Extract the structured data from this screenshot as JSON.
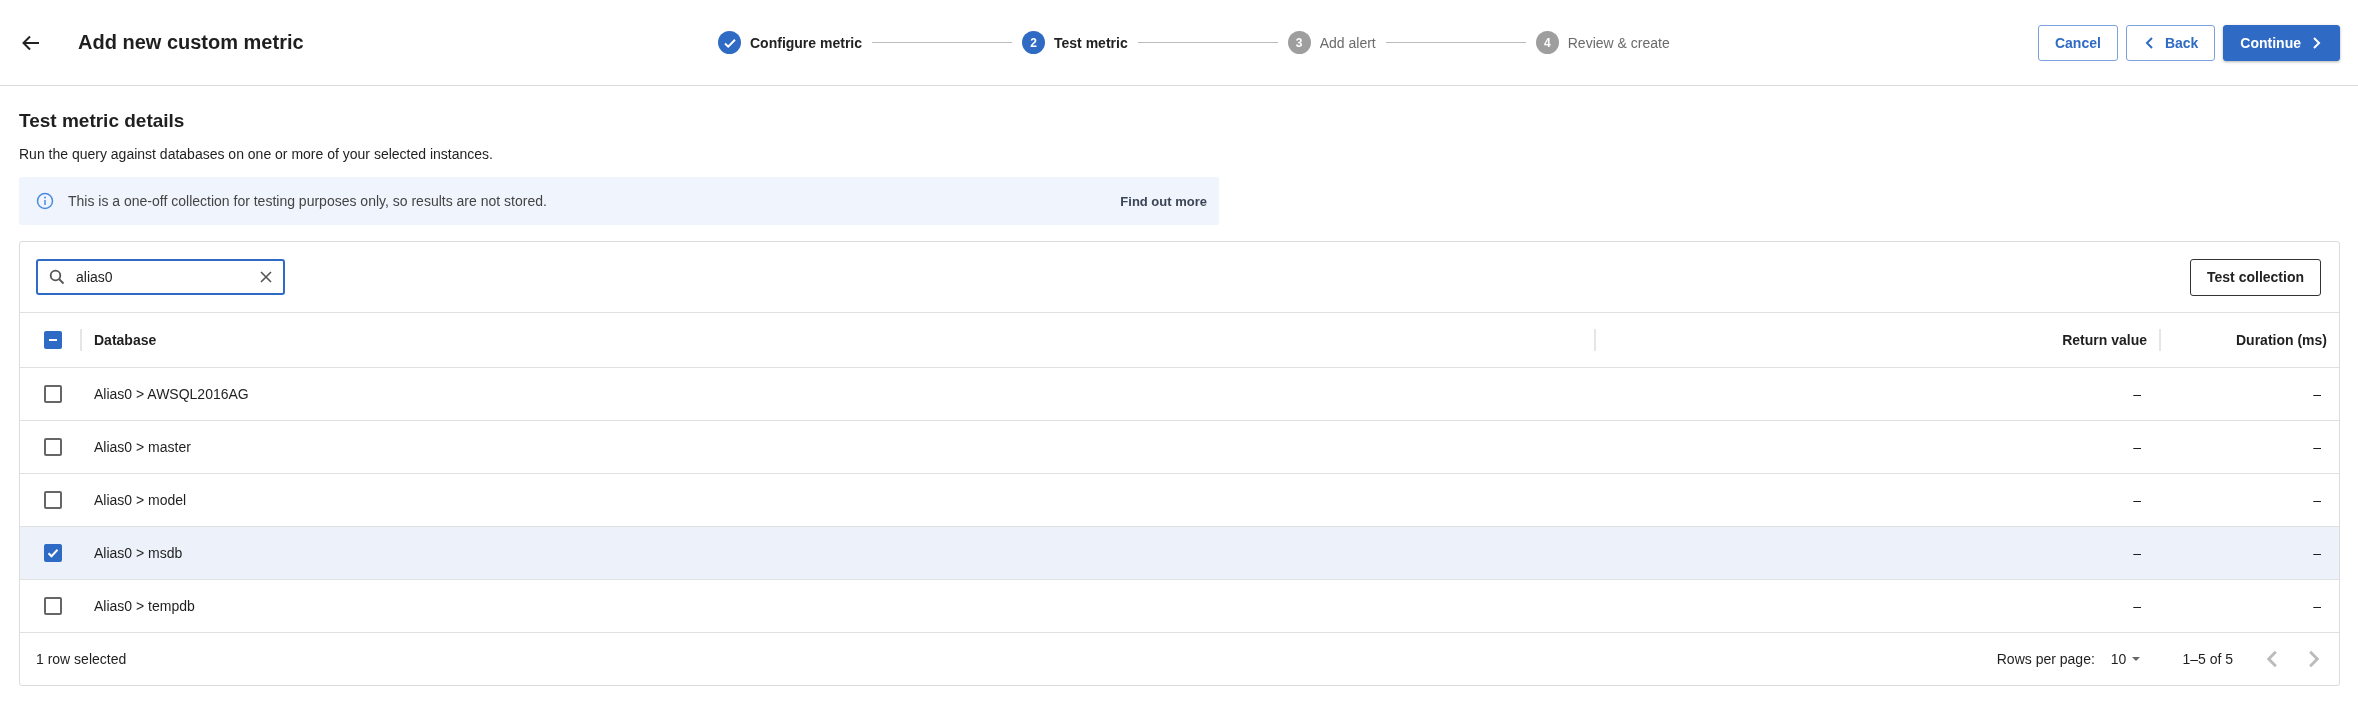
{
  "header": {
    "title": "Add new custom metric"
  },
  "steps": [
    {
      "label": "Configure metric",
      "completed": true,
      "current": false
    },
    {
      "number": "2",
      "label": "Test metric",
      "completed": false,
      "current": true
    },
    {
      "number": "3",
      "label": "Add alert",
      "completed": false,
      "current": false
    },
    {
      "number": "4",
      "label": "Review & create",
      "completed": false,
      "current": false
    }
  ],
  "actions": {
    "cancel": "Cancel",
    "back": "Back",
    "continue": "Continue"
  },
  "section": {
    "title": "Test metric details",
    "description": "Run the query against databases on one or more of your selected instances."
  },
  "info_banner": {
    "text": "This is a one-off collection for testing purposes only, so results are not stored.",
    "link": "Find out more"
  },
  "search": {
    "value": "alias0"
  },
  "test_button": "Test collection",
  "table": {
    "select_all": {
      "checked": true,
      "indeterminate": true
    },
    "columns": [
      "Database",
      "Return value",
      "Duration (ms)"
    ],
    "rows": [
      {
        "database": "Alias0 > AWSQL2016AG",
        "return_value": "–",
        "duration": "–",
        "selected": false
      },
      {
        "database": "Alias0 > master",
        "return_value": "–",
        "duration": "–",
        "selected": false
      },
      {
        "database": "Alias0 > model",
        "return_value": "–",
        "duration": "–",
        "selected": false
      },
      {
        "database": "Alias0 > msdb",
        "return_value": "–",
        "duration": "–",
        "selected": true
      },
      {
        "database": "Alias0 > tempdb",
        "return_value": "–",
        "duration": "–",
        "selected": false
      }
    ]
  },
  "footer": {
    "selection": "1 row selected",
    "rows_per_page_label": "Rows per page:",
    "rows_per_page": "10",
    "range": "1–5 of 5",
    "prev_disabled": true,
    "next_disabled": true
  }
}
